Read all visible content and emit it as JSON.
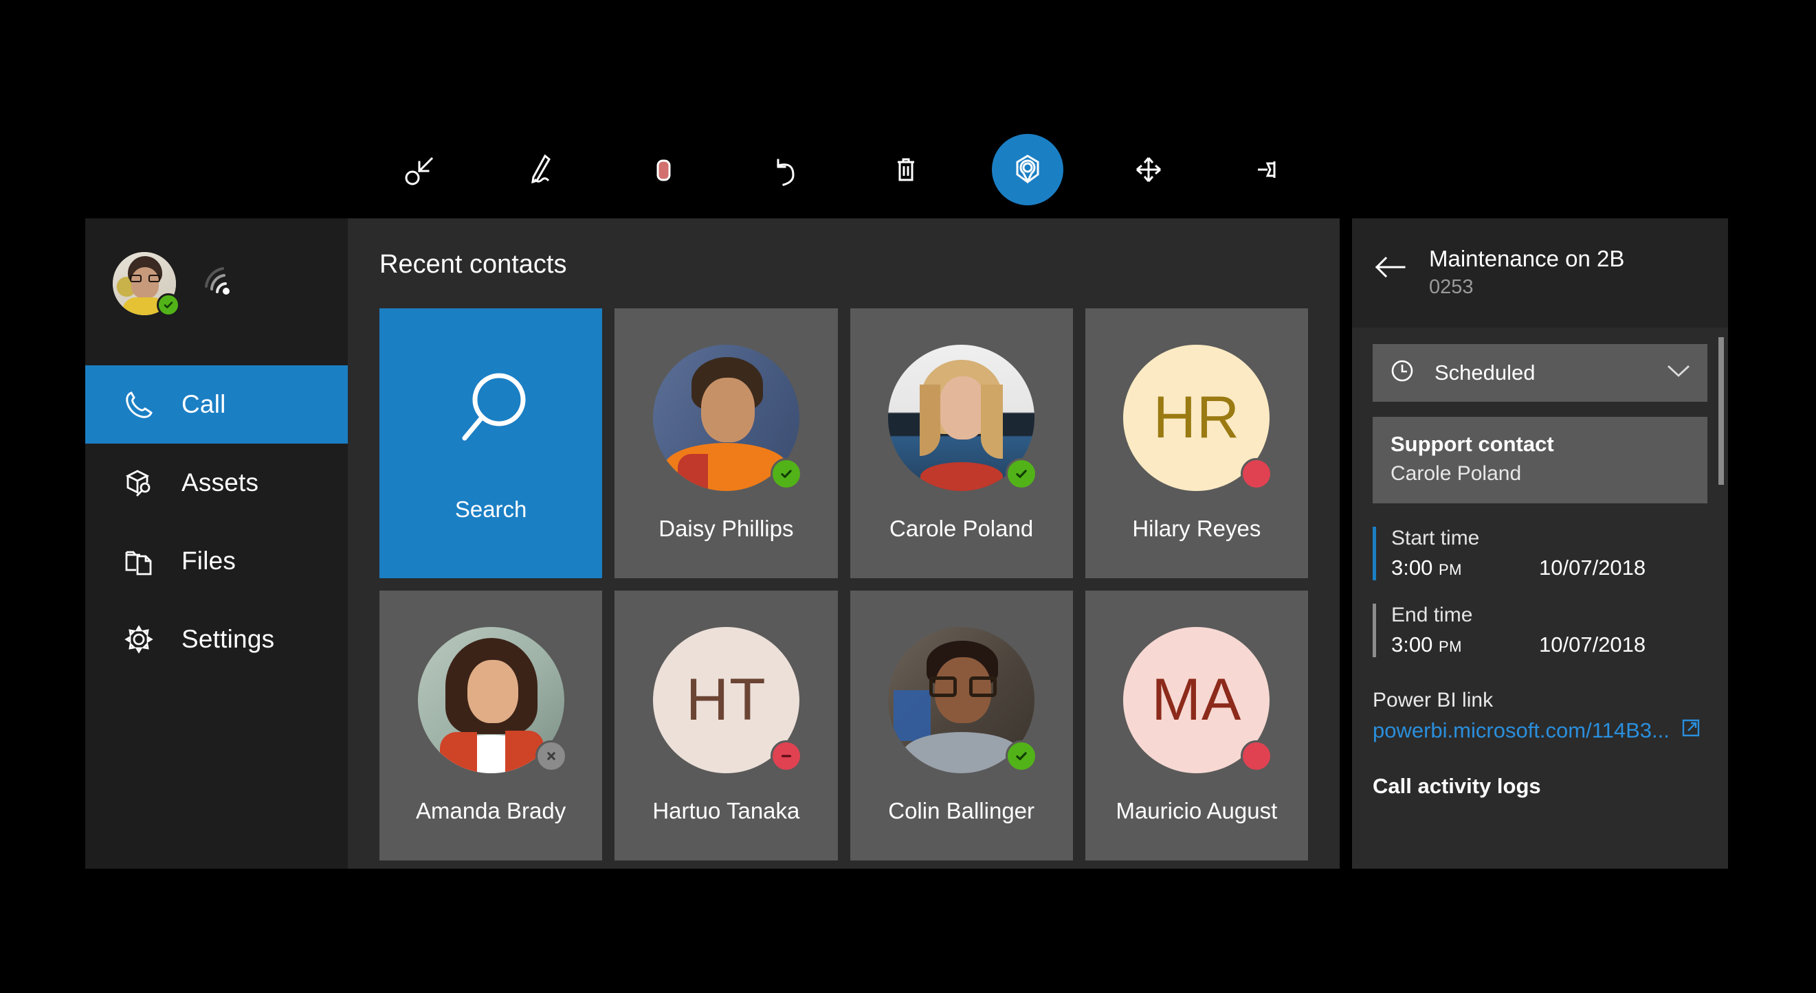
{
  "toolbar": {
    "items": [
      {
        "name": "collapse-icon",
        "label": "Collapse"
      },
      {
        "name": "ink-pen-icon",
        "label": "Ink"
      },
      {
        "name": "color-swatch-icon",
        "label": "Color",
        "color": "#d2716f"
      },
      {
        "name": "undo-icon",
        "label": "Undo"
      },
      {
        "name": "delete-icon",
        "label": "Delete"
      },
      {
        "name": "anchor-marker-icon",
        "label": "Place anchor",
        "active": true,
        "accent": "#1b7fc4"
      },
      {
        "name": "move-icon",
        "label": "Move"
      },
      {
        "name": "pin-icon",
        "label": "Pin"
      }
    ]
  },
  "sidebar": {
    "profile": {
      "status": "available",
      "status_color": "#52b318",
      "wifi_icon": "wifi-icon"
    },
    "items": [
      {
        "label": "Call",
        "icon": "phone-icon",
        "active": true
      },
      {
        "label": "Assets",
        "icon": "assets-icon",
        "active": false
      },
      {
        "label": "Files",
        "icon": "files-icon",
        "active": false
      },
      {
        "label": "Settings",
        "icon": "gear-icon",
        "active": false
      }
    ]
  },
  "main": {
    "heading": "Recent contacts",
    "search_tile": {
      "label": "Search",
      "icon": "search-icon",
      "color": "#1b7fc4"
    },
    "contacts": [
      {
        "name": "Daisy Phillips",
        "type": "photo",
        "status": "available"
      },
      {
        "name": "Carole Poland",
        "type": "photo",
        "status": "available"
      },
      {
        "name": "Hilary Reyes",
        "type": "initials",
        "initials": "HR",
        "bg": "#fbeac3",
        "fg": "#9a7a12",
        "status": "busy"
      },
      {
        "name": "Amanda Brady",
        "type": "photo",
        "status": "offline"
      },
      {
        "name": "Hartuo Tanaka",
        "type": "initials",
        "initials": "HT",
        "bg": "#ece0d9",
        "fg": "#6b4433",
        "status": "dnd"
      },
      {
        "name": "Colin Ballinger",
        "type": "photo",
        "status": "available"
      },
      {
        "name": "Mauricio August",
        "type": "initials",
        "initials": "MA",
        "bg": "#f7d8d2",
        "fg": "#8c2a1b",
        "status": "busy"
      }
    ]
  },
  "right_panel": {
    "back_icon": "back-arrow-icon",
    "title": "Maintenance on 2B",
    "subtitle": "0253",
    "status_dropdown": {
      "label": "Scheduled",
      "icon": "clock-icon",
      "chevron": "chevron-down-icon"
    },
    "support_contact": {
      "title": "Support contact",
      "name": "Carole Poland"
    },
    "start_time": {
      "label": "Start time",
      "time": "3:00",
      "ampm": "PM",
      "date": "10/07/2018",
      "accent": "#1b7fc4"
    },
    "end_time": {
      "label": "End time",
      "time": "3:00",
      "ampm": "PM",
      "date": "10/07/2018",
      "accent": "#8d8d8d"
    },
    "power_bi": {
      "label": "Power BI link",
      "url": "powerbi.microsoft.com/114B3...",
      "icon": "external-link-icon"
    },
    "call_logs_title": "Call activity logs"
  }
}
